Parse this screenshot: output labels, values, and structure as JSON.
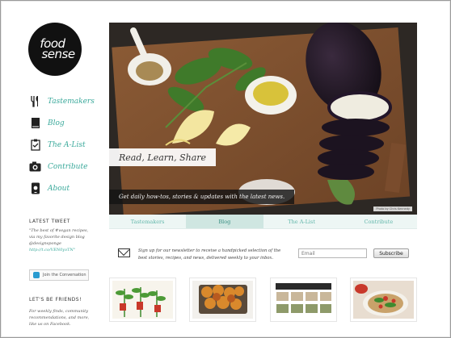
{
  "logo": {
    "line1": "food",
    "line2": "sense"
  },
  "nav": [
    {
      "label": "Tastemakers",
      "icon": "utensils-icon"
    },
    {
      "label": "Blog",
      "icon": "book-icon"
    },
    {
      "label": "The A-List",
      "icon": "clipboard-icon"
    },
    {
      "label": "Contribute",
      "icon": "camera-icon"
    },
    {
      "label": "About",
      "icon": "phone-icon"
    }
  ],
  "sidebar": {
    "latest_tweet_heading": "LATEST TWEET",
    "tweet_text": "\"The best of #vegan recipes, via my favorite design blog @designsponge",
    "tweet_link": "http://t.co/VEN0yvTN\"",
    "join_label": "Join the Conversation",
    "friends_heading": "LET'S BE FRIENDS!",
    "friends_text": "For weekly finds, community recommendations, and more, like us on Facebook."
  },
  "hero": {
    "title": "Read, Learn, Share",
    "subtitle": "Get daily how-tos, stories & updates with the latest news.",
    "credit": "Photo by Chris Kennedy"
  },
  "tabs": [
    {
      "label": "Tastemakers",
      "active": false
    },
    {
      "label": "Blog",
      "active": true
    },
    {
      "label": "The A-List",
      "active": false
    },
    {
      "label": "Contribute",
      "active": false
    }
  ],
  "newsletter": {
    "text": "Sign up for our newsletter to receive a handpicked selection of the best stories, recipes, and news, delivered weekly to your inbox.",
    "placeholder": "Email",
    "button": "Subscribe"
  },
  "colors": {
    "accent": "#3aa99b",
    "tab_bg": "#edf6f4",
    "tab_active": "#cfe6e1"
  }
}
